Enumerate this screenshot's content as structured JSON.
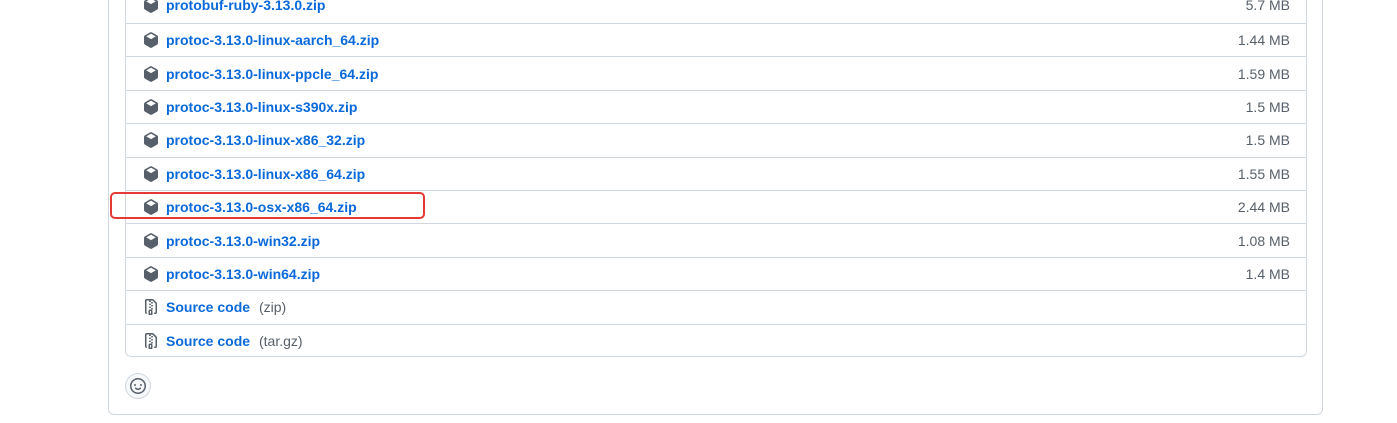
{
  "assets": [
    {
      "name": "protobuf-ruby-3.13.0.zip",
      "size": "5.7 MB",
      "icon": "package-icon"
    },
    {
      "name": "protoc-3.13.0-linux-aarch_64.zip",
      "size": "1.44 MB",
      "icon": "package-icon"
    },
    {
      "name": "protoc-3.13.0-linux-ppcle_64.zip",
      "size": "1.59 MB",
      "icon": "package-icon"
    },
    {
      "name": "protoc-3.13.0-linux-s390x.zip",
      "size": "1.5 MB",
      "icon": "package-icon"
    },
    {
      "name": "protoc-3.13.0-linux-x86_32.zip",
      "size": "1.5 MB",
      "icon": "package-icon"
    },
    {
      "name": "protoc-3.13.0-linux-x86_64.zip",
      "size": "1.55 MB",
      "icon": "package-icon"
    },
    {
      "name": "protoc-3.13.0-osx-x86_64.zip",
      "size": "2.44 MB",
      "icon": "package-icon",
      "highlighted": true
    },
    {
      "name": "protoc-3.13.0-win32.zip",
      "size": "1.08 MB",
      "icon": "package-icon"
    },
    {
      "name": "protoc-3.13.0-win64.zip",
      "size": "1.4 MB",
      "icon": "package-icon"
    },
    {
      "name": "Source code",
      "suffix": "(zip)",
      "icon": "file-zip-icon"
    },
    {
      "name": "Source code",
      "suffix": "(tar.gz)",
      "icon": "file-zip-icon"
    }
  ],
  "reaction": {
    "icon": "smiley-icon"
  },
  "colors": {
    "link": "#0969da",
    "muted": "#57606a",
    "border": "#d0d7de",
    "highlight": "#e53935"
  }
}
